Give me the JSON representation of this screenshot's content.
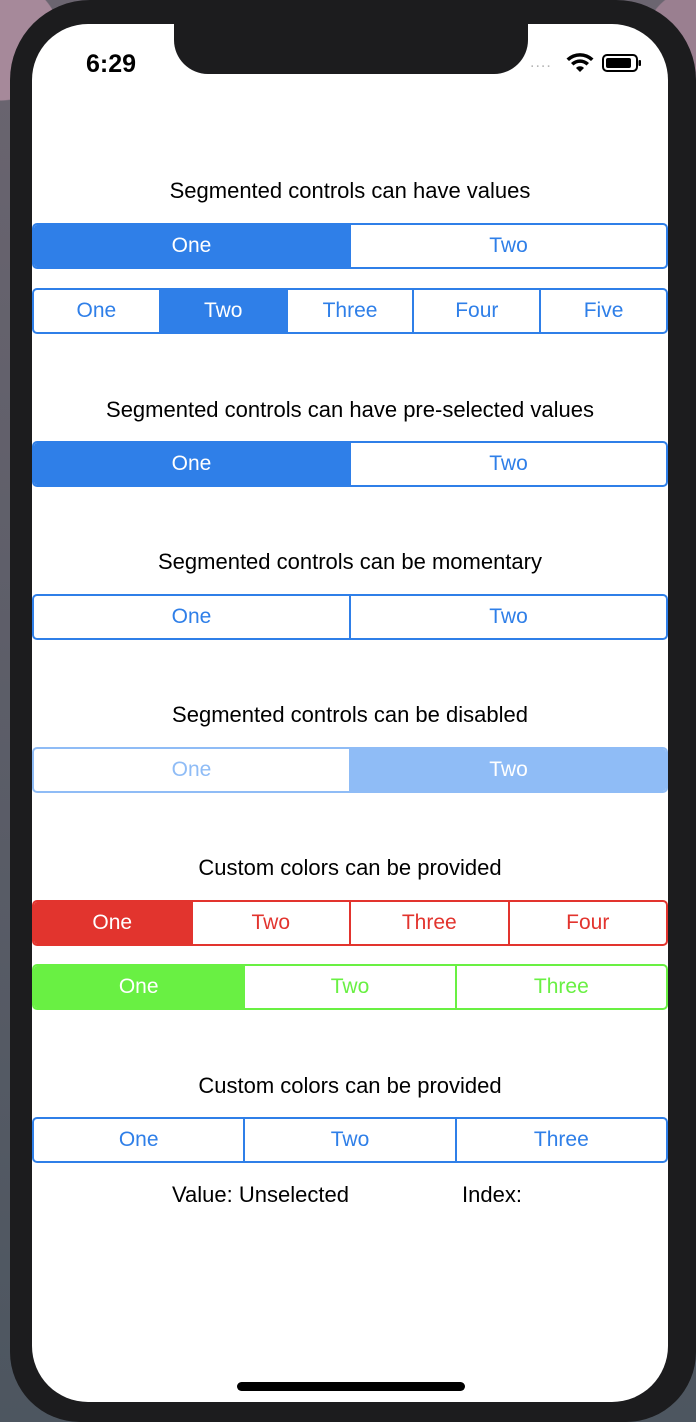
{
  "status_bar": {
    "time": "6:29",
    "signal": "....",
    "wifi_icon": "wifi-icon",
    "battery_icon": "battery-icon"
  },
  "sections": {
    "values": {
      "title": "Segmented controls can have values",
      "control1": [
        "One",
        "Two"
      ],
      "control1_selected": 0,
      "control2": [
        "One",
        "Two",
        "Three",
        "Four",
        "Five"
      ],
      "control2_selected": 1
    },
    "preselected": {
      "title": "Segmented controls can have  pre-selected values",
      "control": [
        "One",
        "Two"
      ],
      "selected": 0
    },
    "momentary": {
      "title": "Segmented controls can be momentary",
      "control": [
        "One",
        "Two"
      ]
    },
    "disabled": {
      "title": "Segmented controls can be disabled",
      "control": [
        "One",
        "Two"
      ],
      "selected": 1
    },
    "custom_colors": {
      "title": "Custom colors can be provided",
      "red_control": [
        "One",
        "Two",
        "Three",
        "Four"
      ],
      "red_selected": 0,
      "green_control": [
        "One",
        "Two",
        "Three"
      ],
      "green_selected": 0
    },
    "custom_colors_2": {
      "title": "Custom colors can be provided",
      "control": [
        "One",
        "Two",
        "Three"
      ],
      "value_label": "Value: Unselected",
      "index_label": "Index:"
    }
  },
  "colors": {
    "accent_blue": "#2f7fe8",
    "disabled_blue": "#8fbcf6",
    "custom_red": "#e2342e",
    "custom_green": "#69f043"
  }
}
